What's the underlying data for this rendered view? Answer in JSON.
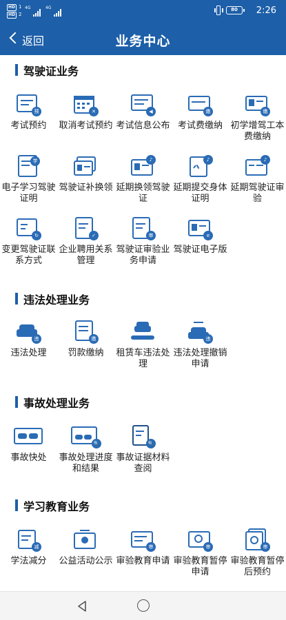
{
  "status_bar": {
    "sim1_label": "HD",
    "sim1_num": "1",
    "sim2_label": "HD",
    "sim2_num": "2",
    "network": "4G",
    "battery": "80",
    "time": "2:26"
  },
  "header": {
    "back_label": "返回",
    "title": "业务中心"
  },
  "colors": {
    "primary": "#1d5fa8",
    "icon": "#2a6bb5"
  },
  "sections": [
    {
      "title": "驾驶证业务",
      "items": [
        {
          "label": "考试预约",
          "icon": "exam-booking-icon",
          "badge": "预"
        },
        {
          "label": "取消考试预约",
          "icon": "calendar-cancel-icon",
          "badge": "✕"
        },
        {
          "label": "考试信息公布",
          "icon": "announcement-card-icon",
          "badge": "◀"
        },
        {
          "label": "考试费缴纳",
          "icon": "fee-card-icon",
          "badge": "缴"
        },
        {
          "label": "初学增驾工本费缴纳",
          "icon": "id-card-fee-icon",
          "badge": "缴"
        },
        {
          "label": "电子学习驾驶证明",
          "icon": "learning-certificate-icon",
          "badge": "学"
        },
        {
          "label": "驾驶证补换领",
          "icon": "license-replace-icon",
          "badge": "⇄"
        },
        {
          "label": "延期换领驾驶证",
          "icon": "license-extend-icon",
          "badge": "♪"
        },
        {
          "label": "延期提交身体证明",
          "icon": "health-certificate-icon",
          "badge": "♪"
        },
        {
          "label": "延期驾驶证审验",
          "icon": "license-review-extend-icon",
          "badge": "♪"
        },
        {
          "label": "变更驾驶证联系方式",
          "icon": "contact-change-icon",
          "badge": "↻"
        },
        {
          "label": "企业聘用关系管理",
          "icon": "enterprise-doc-icon",
          "badge": "✓"
        },
        {
          "label": "驾驶证审验业务申请",
          "icon": "review-application-icon",
          "badge": "审"
        },
        {
          "label": "驾驶证电子版",
          "icon": "e-license-icon",
          "badge": "e"
        }
      ]
    },
    {
      "title": "违法处理业务",
      "items": [
        {
          "label": "违法处理",
          "icon": "violation-car-icon",
          "badge": "违"
        },
        {
          "label": "罚款缴纳",
          "icon": "fine-payment-icon",
          "badge": "缴"
        },
        {
          "label": "租赁车违法处理",
          "icon": "rental-car-icon",
          "badge": ""
        },
        {
          "label": "违法处理撤销申请",
          "icon": "violation-revoke-icon",
          "badge": "违"
        }
      ]
    },
    {
      "title": "事故处理业务",
      "items": [
        {
          "label": "事故快处",
          "icon": "quick-accident-icon",
          "badge": ""
        },
        {
          "label": "事故处理进度和结果",
          "icon": "accident-progress-icon",
          "badge": "🔍"
        },
        {
          "label": "事故证据材料查阅",
          "icon": "evidence-search-icon",
          "badge": "🔍"
        }
      ]
    },
    {
      "title": "学习教育业务",
      "items": [
        {
          "label": "学法减分",
          "icon": "study-points-icon",
          "badge": "减"
        },
        {
          "label": "公益活动公示",
          "icon": "charity-icon",
          "badge": ""
        },
        {
          "label": "审验教育申请",
          "icon": "review-education-icon",
          "badge": "审"
        },
        {
          "label": "审验教育暂停申请",
          "icon": "education-pause-icon",
          "badge": "审"
        },
        {
          "label": "审验教育暂停后预约",
          "icon": "education-resume-icon",
          "badge": "审"
        }
      ]
    }
  ]
}
